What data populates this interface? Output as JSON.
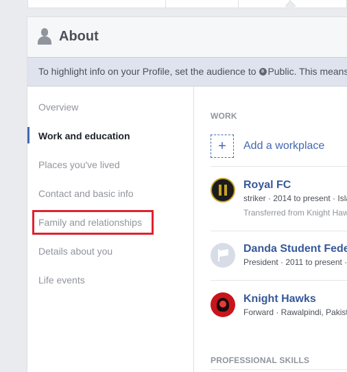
{
  "about": {
    "title": "About",
    "banner_prefix": "To highlight info on your Profile, set the audience to ",
    "banner_audience": "Public",
    "banner_suffix": ". This means"
  },
  "nav": {
    "items": [
      {
        "label": "Overview"
      },
      {
        "label": "Work and education"
      },
      {
        "label": "Places you've lived"
      },
      {
        "label": "Contact and basic info"
      },
      {
        "label": "Family and relationships"
      },
      {
        "label": "Details about you"
      },
      {
        "label": "Life events"
      }
    ]
  },
  "work": {
    "section_label": "WORK",
    "add_label": "Add a workplace",
    "entries": [
      {
        "name": "Royal FC",
        "details": "striker · 2014 to present · Isla",
        "extra": "Transferred from Knight Haw"
      },
      {
        "name": "Danda Student Fede",
        "details": "President · 2011 to present ·"
      },
      {
        "name": "Knight Hawks",
        "details": "Forward · Rawalpindi, Pakist"
      }
    ]
  },
  "skills": {
    "section_label": "PROFESSIONAL SKILLS"
  },
  "colors": {
    "link": "#365899",
    "accent": "#4267b2",
    "highlight_box": "#e0202e"
  }
}
